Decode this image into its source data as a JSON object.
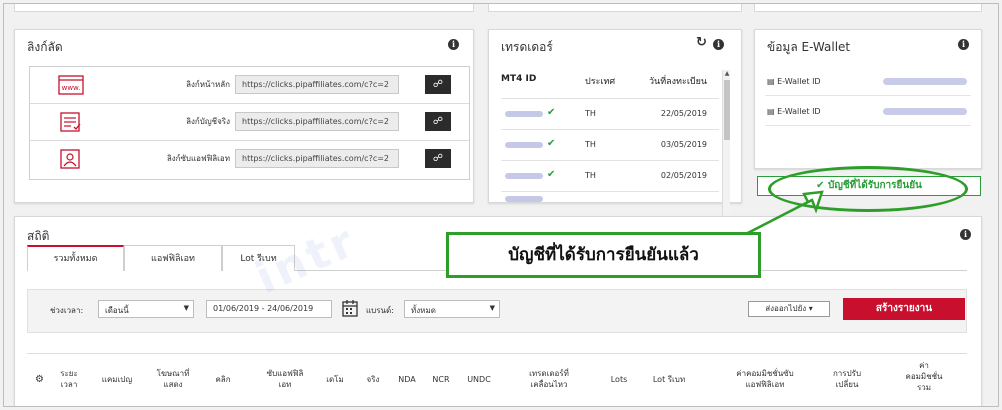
{
  "links_panel": {
    "title": "ลิงก์ลัด",
    "rows": [
      {
        "label": "ลิงก์หน้าหลัก",
        "url": "https://clicks.pipaffiliates.com/c?c=2",
        "icon": "www-icon"
      },
      {
        "label": "ลิงก์บัญชีจริง",
        "url": "https://clicks.pipaffiliates.com/c?c=2",
        "icon": "form-icon"
      },
      {
        "label": "ลิงก์ซับแอฟฟิลิเอท",
        "url": "https://clicks.pipaffiliates.com/c?c=2",
        "icon": "user-card-icon"
      }
    ]
  },
  "traders_panel": {
    "title": "เทรดเดอร์",
    "columns": [
      "MT4 ID",
      "ประเทศ",
      "วันที่ลงทะเบียน"
    ],
    "rows": [
      {
        "country": "TH",
        "date": "22/05/2019"
      },
      {
        "country": "TH",
        "date": "03/05/2019"
      },
      {
        "country": "TH",
        "date": "02/05/2019"
      }
    ]
  },
  "ewallet_panel": {
    "title": "ข้อมูล E-Wallet",
    "rows": [
      {
        "label": "E-Wallet ID"
      },
      {
        "label": "E-Wallet ID"
      }
    ],
    "verified_label": "บัญชีที่ได้รับการยืนยัน"
  },
  "stats_panel": {
    "title": "สถิติ",
    "tabs": [
      "รวมทั้งหมด",
      "แอฟฟิลิเอท",
      "Lot รีเบท"
    ],
    "filters": {
      "period_label": "ช่วงเวลา:",
      "period_value": "เดือนนี้",
      "date_range": "01/06/2019 - 24/06/2019",
      "brand_label": "แบรนด์:",
      "brand_value": "ทั้งหมด",
      "export_label": "ส่งออกไปยัง ▾",
      "create_report_label": "สร้างรายงาน"
    },
    "columns": [
      [
        "ระยะ",
        "เวลา"
      ],
      [
        "แคมเปญ"
      ],
      [
        "โฆษณาที่",
        "แสดง"
      ],
      [
        "คลิก"
      ],
      [
        "ซับแอฟฟิลิ",
        "เอท"
      ],
      [
        "เดโม"
      ],
      [
        "จริง"
      ],
      [
        "NDA"
      ],
      [
        "NCR"
      ],
      [
        "UNDC"
      ],
      [
        "เทรดเดอร์ที่",
        "เคลื่อนไหว"
      ],
      [
        "Lots"
      ],
      [
        "Lot รีเบท"
      ],
      [
        "ค่าคอมมิชชั่นซับ",
        "แอฟฟิลิเอท"
      ],
      [
        "การปรับ",
        "เปลี่ยน"
      ],
      [
        "ค่า",
        "คอมมิชชั่น",
        "รวม"
      ]
    ]
  },
  "callout": {
    "text": "บัญชีที่ได้รับการยืนยันแล้ว",
    "color": "#2e9e2a"
  },
  "colors": {
    "brand_red": "#c8102e",
    "verified_green": "#2a9d3a"
  }
}
